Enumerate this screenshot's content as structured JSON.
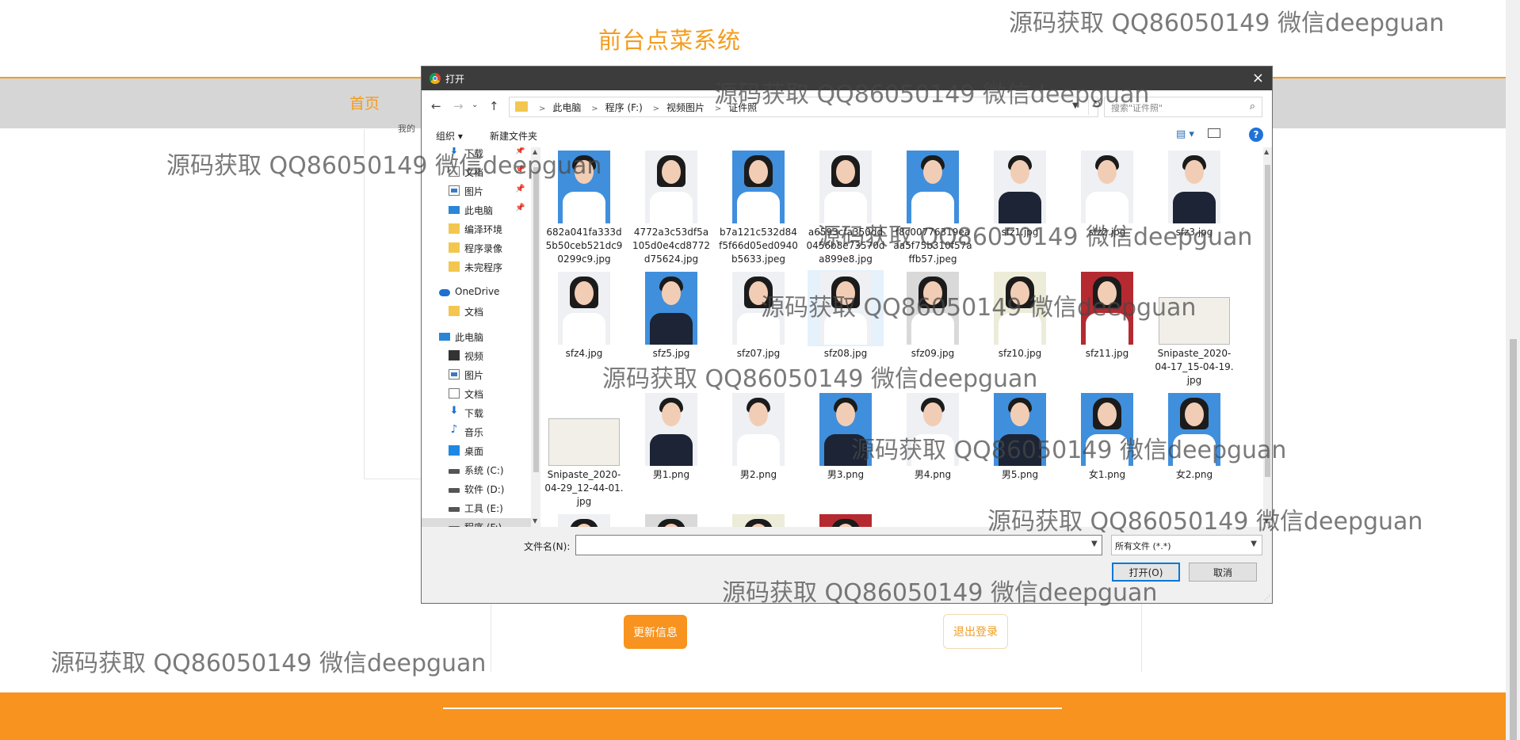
{
  "site": {
    "title": "前台点菜系统",
    "nav_home": "首页",
    "nav_fragment": "我的",
    "update_button": "更新信息",
    "logout_button": "退出登录",
    "accent_color": "#f39c1e"
  },
  "dialog": {
    "title": "打开",
    "close_icon": "×",
    "back_icon": "←",
    "forward_icon": "→",
    "recent_icon": "⌄",
    "up_icon": "↑",
    "breadcrumbs": [
      "此电脑",
      "程序 (F:)",
      "视频图片",
      "证件照"
    ],
    "search_placeholder": "搜索\"证件照\"",
    "toolbar": {
      "organize": "组织 ▾",
      "new_folder": "新建文件夹",
      "help": "?"
    },
    "nav_items": [
      {
        "label": "下载",
        "icon": "download-icon",
        "pinned": true
      },
      {
        "label": "文档",
        "icon": "document-icon",
        "pinned": true
      },
      {
        "label": "图片",
        "icon": "pictures-icon",
        "pinned": true
      },
      {
        "label": "此电脑",
        "icon": "computer-icon",
        "pinned": true
      },
      {
        "label": "编泽环境",
        "icon": "folder-icon",
        "pinned": false
      },
      {
        "label": "程序录像",
        "icon": "folder-icon",
        "pinned": false
      },
      {
        "label": "未完程序",
        "icon": "folder-icon",
        "pinned": false
      },
      {
        "label": "OneDrive",
        "icon": "cloud-icon",
        "pinned": false
      },
      {
        "label": "文档",
        "icon": "folder-icon",
        "pinned": false
      },
      {
        "label": "此电脑",
        "icon": "computer-icon",
        "pinned": false
      },
      {
        "label": "视频",
        "icon": "video-icon",
        "pinned": false
      },
      {
        "label": "图片",
        "icon": "pictures-icon",
        "pinned": false
      },
      {
        "label": "文档",
        "icon": "document-icon",
        "pinned": false
      },
      {
        "label": "下载",
        "icon": "download-icon",
        "pinned": false
      },
      {
        "label": "音乐",
        "icon": "music-icon",
        "pinned": false
      },
      {
        "label": "桌面",
        "icon": "desktop-icon",
        "pinned": false
      },
      {
        "label": "系统 (C:)",
        "icon": "drive-icon",
        "pinned": false
      },
      {
        "label": "软件 (D:)",
        "icon": "drive-icon",
        "pinned": false
      },
      {
        "label": "工具 (E:)",
        "icon": "drive-icon",
        "pinned": false
      },
      {
        "label": "程序 (F:)",
        "icon": "drive-icon",
        "pinned": false
      }
    ],
    "files": [
      {
        "name": "682a041fa333d5b50ceb521dc90299c9.jpg",
        "kind": "blue-male"
      },
      {
        "name": "4772a3c53df5a105d0e4cd8772d75624.jpg",
        "kind": "white-female"
      },
      {
        "name": "b7a121c532d84f5f66d05ed0940b5633.jpeg",
        "kind": "blue-female"
      },
      {
        "name": "a6593cfa350dd0456b8e73570da899e8.jpg",
        "kind": "white-female"
      },
      {
        "name": "f8c00776319eaaa5f75b310f57affb57.jpeg",
        "kind": "blue-male"
      },
      {
        "name": "sfz1.jpg",
        "kind": "white-male"
      },
      {
        "name": "sfz2.jpg",
        "kind": "white-male"
      },
      {
        "name": "sfz3.jpg",
        "kind": "white-male"
      },
      {
        "name": "sfz4.jpg",
        "kind": "white-female"
      },
      {
        "name": "sfz5.jpg",
        "kind": "blue-male"
      },
      {
        "name": "sfz07.jpg",
        "kind": "white-female"
      },
      {
        "name": "sfz08.jpg",
        "kind": "white-female",
        "selected": true
      },
      {
        "name": "sfz09.jpg",
        "kind": "gray-female"
      },
      {
        "name": "sfz10.jpg",
        "kind": "cream-female"
      },
      {
        "name": "sfz11.jpg",
        "kind": "red-female"
      },
      {
        "name": "Snipaste_2020-04-17_15-04-19.jpg",
        "kind": "card"
      },
      {
        "name": "Snipaste_2020-04-29_12-44-01.jpg",
        "kind": "card"
      },
      {
        "name": "男1.png",
        "kind": "white-male"
      },
      {
        "name": "男2.png",
        "kind": "white-male"
      },
      {
        "name": "男3.png",
        "kind": "blue-male"
      },
      {
        "name": "男4.png",
        "kind": "white-male"
      },
      {
        "name": "男5.png",
        "kind": "blue-male"
      },
      {
        "name": "女1.png",
        "kind": "blue-female"
      },
      {
        "name": "女2.png",
        "kind": "blue-female"
      },
      {
        "name": "",
        "kind": "white-female"
      },
      {
        "name": "",
        "kind": "gray-female"
      },
      {
        "name": "",
        "kind": "cream-female"
      },
      {
        "name": "",
        "kind": "red-female"
      }
    ],
    "filename_label": "文件名(N):",
    "filename_value": "",
    "filetype_value": "所有文件 (*.*)",
    "open_button": "打开(O)",
    "cancel_button": "取消",
    "focus_color": "#0078d7"
  },
  "watermark_text": "源码获取 QQ86050149 微信deepguan"
}
